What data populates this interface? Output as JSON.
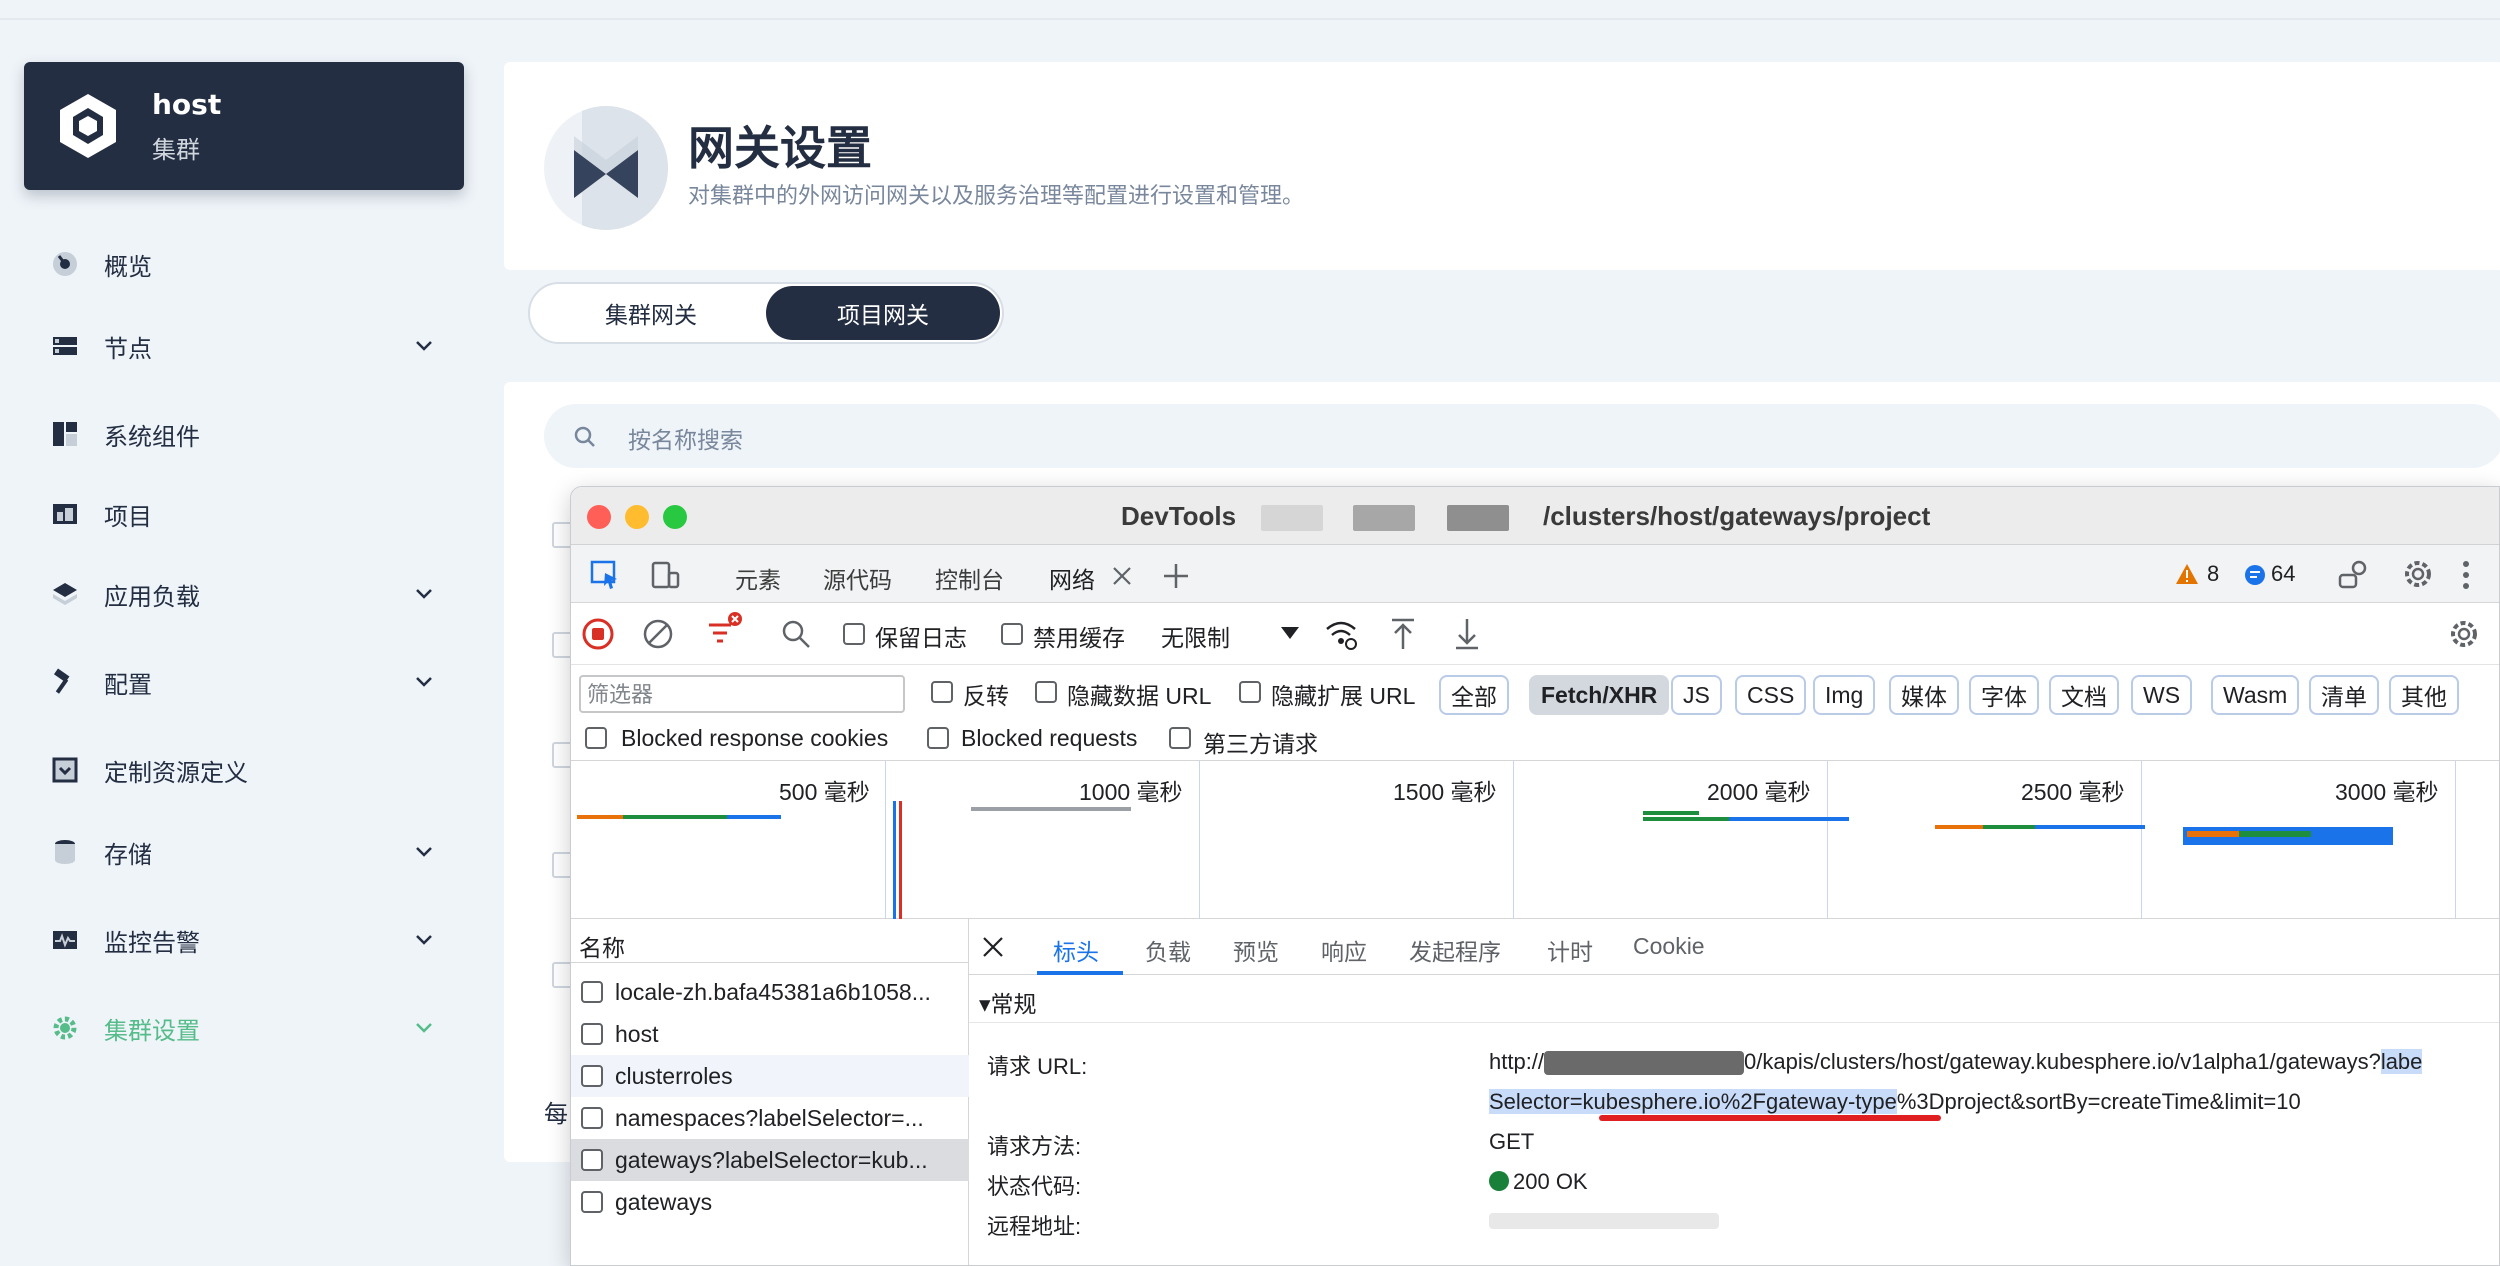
{
  "sidebar": {
    "cluster": {
      "name": "host",
      "subtitle": "集群"
    },
    "items": [
      {
        "label": "概览",
        "icon": "dashboard-icon",
        "has_children": false,
        "active": false
      },
      {
        "label": "节点",
        "icon": "nodes-icon",
        "has_children": true,
        "active": false
      },
      {
        "label": "系统组件",
        "icon": "components-icon",
        "has_children": false,
        "active": false
      },
      {
        "label": "项目",
        "icon": "project-icon",
        "has_children": false,
        "active": false
      },
      {
        "label": "应用负载",
        "icon": "workload-icon",
        "has_children": true,
        "active": false
      },
      {
        "label": "配置",
        "icon": "hammer-icon",
        "has_children": true,
        "active": false
      },
      {
        "label": "定制资源定义",
        "icon": "crd-icon",
        "has_children": false,
        "active": false
      },
      {
        "label": "存储",
        "icon": "database-icon",
        "has_children": true,
        "active": false
      },
      {
        "label": "监控告警",
        "icon": "monitor-icon",
        "has_children": true,
        "active": false
      },
      {
        "label": "集群设置",
        "icon": "gear-icon",
        "has_children": true,
        "active": true
      }
    ]
  },
  "header": {
    "title": "网关设置",
    "description": "对集群中的外网访问网关以及服务治理等配置进行设置和管理。"
  },
  "tabs": [
    {
      "label": "集群网关",
      "active": false
    },
    {
      "label": "项目网关",
      "active": true
    }
  ],
  "search": {
    "placeholder": "按名称搜索"
  },
  "list_footer_partial": "每",
  "devtools": {
    "window_title": "DevTools",
    "url_path": "/clusters/host/gateways/project",
    "tabs": [
      "元素",
      "源代码",
      "控制台",
      "网络"
    ],
    "active_tab": "网络",
    "warnings": "8",
    "messages": "64",
    "toolbar": {
      "preserve_log": "保留日志",
      "disable_cache": "禁用缓存",
      "throttle": "无限制"
    },
    "filter": {
      "placeholder": "筛选器",
      "invert": "反转",
      "hide_data_urls": "隐藏数据 URL",
      "hide_extension_urls": "隐藏扩展 URL",
      "types": [
        "全部",
        "Fetch/XHR",
        "JS",
        "CSS",
        "Img",
        "媒体",
        "字体",
        "文档",
        "WS",
        "Wasm",
        "清单",
        "其他"
      ],
      "selected_type": "Fetch/XHR"
    },
    "row4": {
      "blocked_cookies": "Blocked response cookies",
      "blocked_requests": "Blocked requests",
      "third_party": "第三方请求"
    },
    "timeline_ticks": [
      "500 毫秒",
      "1000 毫秒",
      "1500 毫秒",
      "2000 毫秒",
      "2500 毫秒",
      "3000 毫秒"
    ],
    "name_header": "名称",
    "requests": [
      "locale-zh.bafa45381a6b1058...",
      "host",
      "clusterroles",
      "namespaces?labelSelector=...",
      "gateways?labelSelector=kub...",
      "gateways"
    ],
    "selected_request_index": 4,
    "detail_tabs": [
      "标头",
      "负载",
      "预览",
      "响应",
      "发起程序",
      "计时",
      "Cookie"
    ],
    "active_detail_tab": "标头",
    "general_section": "▾常规",
    "general": {
      "request_url_key": "请求 URL:",
      "request_url_line1_prefix": "http://",
      "request_url_line1_suffix": "0/kapis/clusters/host/gateway.kubesphere.io/v1alpha1/gateways?",
      "request_url_line1_hl": "labe",
      "request_url_line2_hl": "Selector=kubesphere.io%2Fgateway-type",
      "request_url_line2_rest": "%3Dproject&sortBy=createTime&limit=10",
      "method_key": "请求方法:",
      "method_val": "GET",
      "status_key": "状态代码:",
      "status_val": "200 OK",
      "remote_key": "远程地址:"
    },
    "colors": {
      "status_ok": "#188038",
      "accent": "#1a73e8",
      "close_light": "#ff5f57",
      "min_light": "#febc2e",
      "max_light": "#28c840"
    }
  }
}
